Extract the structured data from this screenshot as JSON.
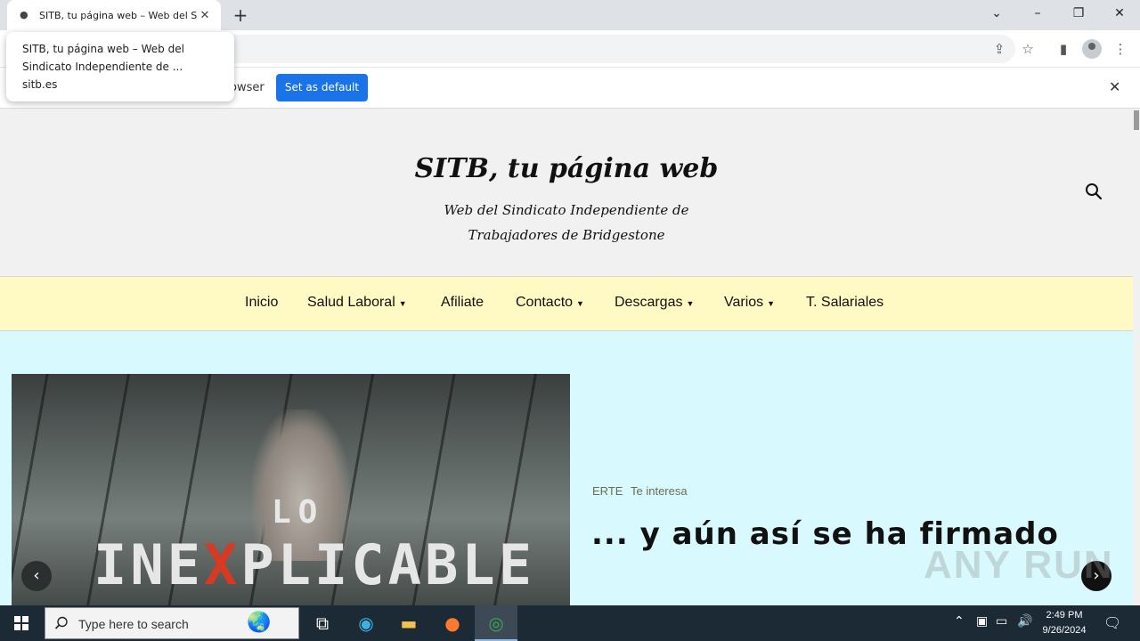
{
  "browser": {
    "tab_title": "SITB, tu página web – Web del Si",
    "tooltip": {
      "line1": "SITB, tu página web – Web del",
      "line2": "Sindicato Independiente de ...",
      "domain": "sitb.es"
    },
    "infobar": {
      "partial_text": "owser",
      "button_label": "Set as default"
    }
  },
  "site": {
    "title": "SITB, tu página web",
    "description": "Web del Sindicato Independiente de Trabajadores de Bridgestone",
    "nav": [
      {
        "label": "Inicio",
        "dropdown": false
      },
      {
        "label": "Salud Laboral",
        "dropdown": true
      },
      {
        "label": "Afiliate",
        "dropdown": false
      },
      {
        "label": "Contacto",
        "dropdown": true
      },
      {
        "label": "Descargas",
        "dropdown": true
      },
      {
        "label": "Varios",
        "dropdown": true
      },
      {
        "label": "T. Salariales",
        "dropdown": false
      }
    ],
    "slide": {
      "image_text_top": "LO",
      "image_text_a": "INE",
      "image_text_x": "X",
      "image_text_b": "PLICABLE",
      "categories": [
        "ERTE",
        "Te interesa"
      ],
      "title": "... y aún así se ha firmado"
    }
  },
  "watermark": "ANY RUN",
  "taskbar": {
    "search_placeholder": "Type here to search",
    "time": "2:49 PM",
    "date": "9/26/2024"
  },
  "colors": {
    "nav_bg": "#fff9c4",
    "hero_bg": "#d8fafe",
    "accent_button": "#1a73e8"
  }
}
